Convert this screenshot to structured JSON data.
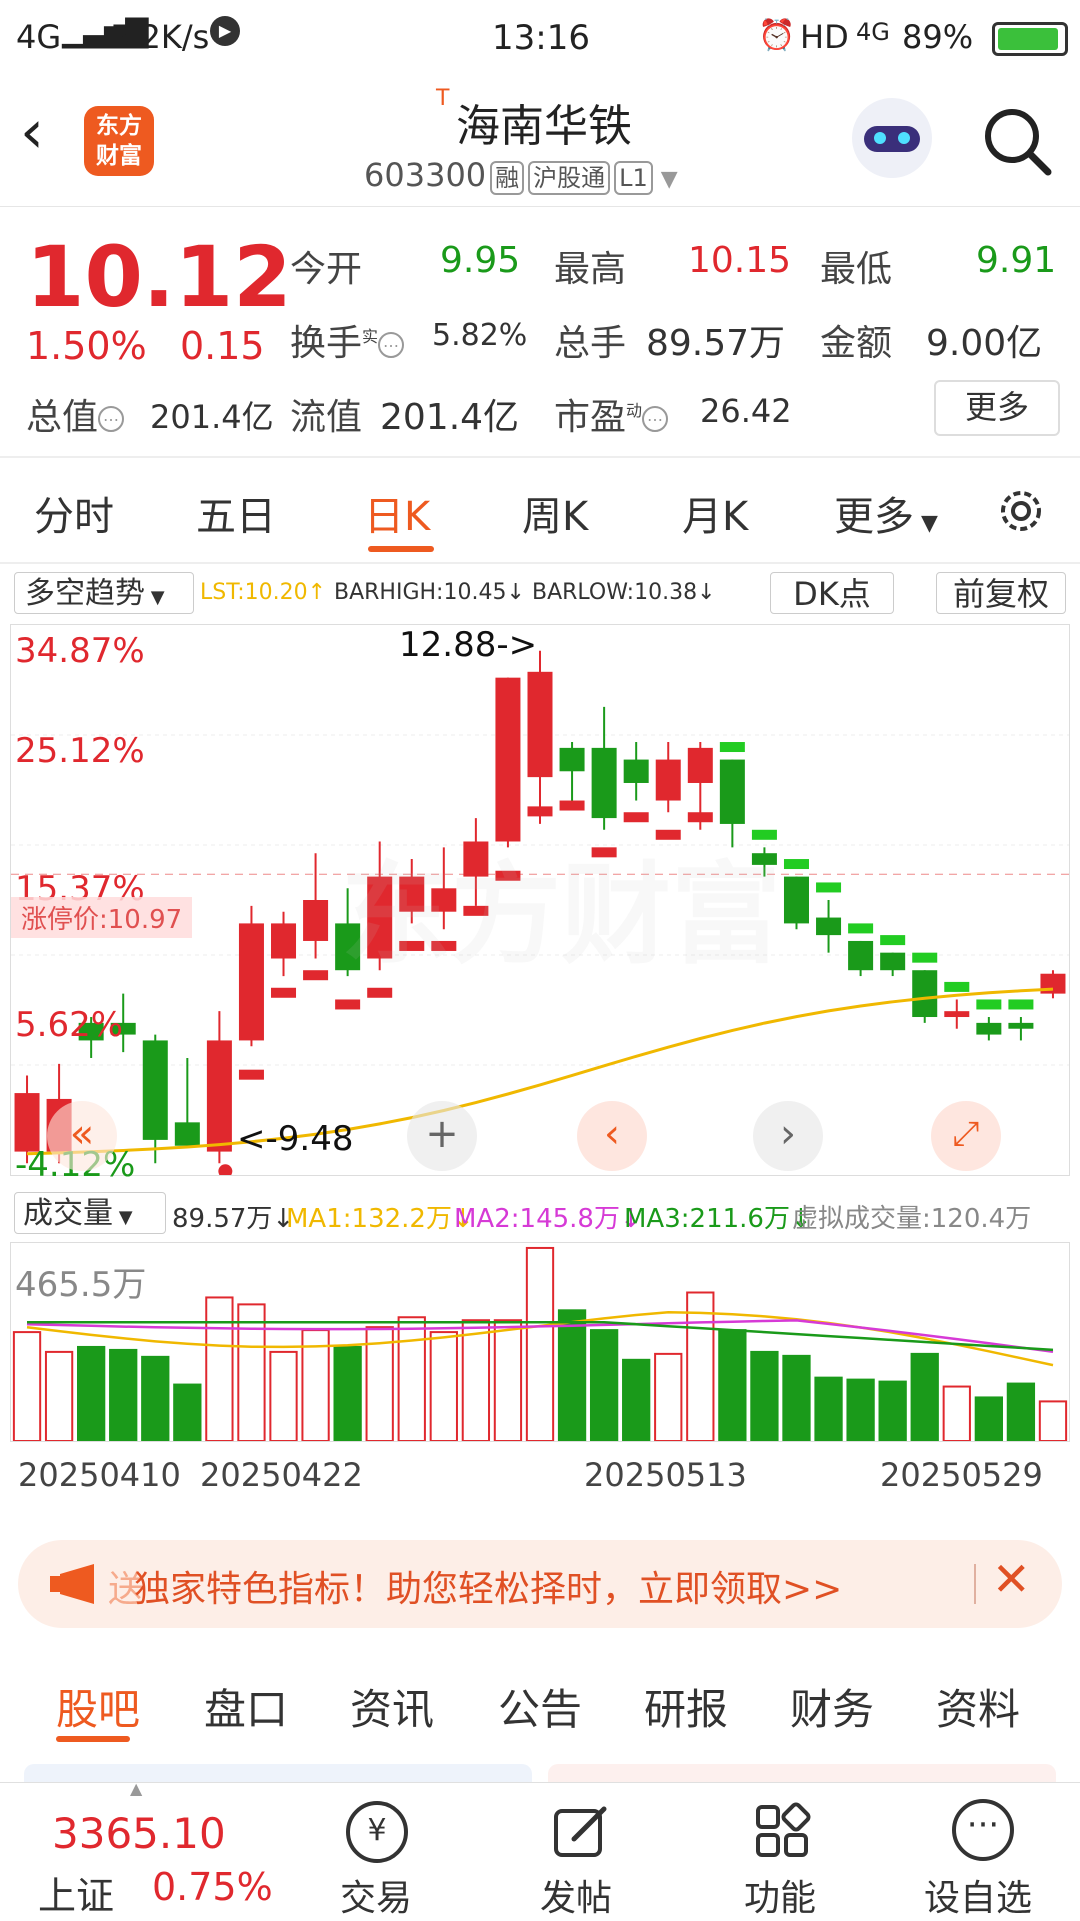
{
  "status_bar": {
    "network": "4G",
    "speed": "5.2K/s",
    "time": "13:16",
    "hd": "HD",
    "net2": "4G",
    "battery": "89%"
  },
  "header": {
    "logo_text": "东方\n财富",
    "prefix": "T",
    "stock_name": "海南华铁",
    "stock_code": "603300",
    "tags": [
      "融",
      "沪股通",
      "L1"
    ]
  },
  "quote": {
    "price": "10.12",
    "change_pct": "1.50%",
    "change": "0.15",
    "open_label": "今开",
    "open": "9.95",
    "high_label": "最高",
    "high": "10.15",
    "low_label": "最低",
    "low": "9.91",
    "turnover_label": "换手",
    "turnover_sup": "实",
    "turnover": "5.82%",
    "volume_label": "总手",
    "volume": "89.57万",
    "amount_label": "金额",
    "amount": "9.00亿",
    "mktcap_label": "总值",
    "mktcap": "201.4亿",
    "float_label": "流值",
    "float": "201.4亿",
    "pe_label": "市盈",
    "pe_sup": "动",
    "pe": "26.42",
    "more": "更多"
  },
  "period_tabs": [
    "分时",
    "五日",
    "日K",
    "周K",
    "月K",
    "更多"
  ],
  "active_tab": "日K",
  "indicator_bar": {
    "selector": "多空趋势",
    "lst": "LST:10.20↑",
    "barhigh": "BARHIGH:10.45↓",
    "barlow": "BARLOW:10.38↓",
    "dk_button": "DK点",
    "adjust_button": "前复权"
  },
  "kchart_labels": {
    "y_top": "34.87%",
    "y2": "25.12%",
    "y3": "15.37%",
    "y4": "5.62%",
    "y_bottom": "-4.12%",
    "limit_up": "涨停价:10.97",
    "high_marker": "12.88->",
    "low_marker": "<-9.48",
    "watermark": "东方财富"
  },
  "volume_bar": {
    "selector": "成交量",
    "vol": "89.57万↓",
    "ma1": "MA1:132.2万↓",
    "ma2": "MA2:145.8万↓",
    "ma3": "MA3:211.6万↓",
    "virtual": "虚拟成交量:120.4万",
    "max_label": "465.5万"
  },
  "dates": [
    "20250410",
    "20250422",
    "20250513",
    "20250529"
  ],
  "banner": {
    "text": "独家特色指标！助您轻松择时，立即领取>>",
    "prefix": "送"
  },
  "bottom_tabs": [
    "股吧",
    "盘口",
    "资讯",
    "公告",
    "研报",
    "财务",
    "资料"
  ],
  "footer": {
    "index_value": "3365.10",
    "index_name": "上证",
    "index_change": "0.75%",
    "items": [
      "交易",
      "发帖",
      "功能",
      "设自选"
    ]
  },
  "colors": {
    "up": "#e0282e",
    "down": "#1a9a1a",
    "accent": "#ee5a20",
    "ma": "#f0b800"
  },
  "chart_data": {
    "type": "candlestick",
    "y_range_pct": [
      -4.12,
      34.87
    ],
    "candles": [
      {
        "o": 8.6,
        "h": 9.25,
        "l": 8.5,
        "c": 9.1
      },
      {
        "o": 8.6,
        "h": 9.35,
        "l": 8.5,
        "c": 9.05
      },
      {
        "o": 9.7,
        "h": 9.75,
        "l": 9.4,
        "c": 9.55
      },
      {
        "o": 9.7,
        "h": 9.95,
        "l": 9.45,
        "c": 9.6
      },
      {
        "o": 9.55,
        "h": 9.6,
        "l": 8.5,
        "c": 8.7
      },
      {
        "o": 8.85,
        "h": 9.4,
        "l": 8.75,
        "c": 8.65
      },
      {
        "o": 8.6,
        "h": 9.8,
        "l": 8.5,
        "c": 9.55
      },
      {
        "o": 9.55,
        "h": 10.7,
        "l": 9.5,
        "c": 10.55
      },
      {
        "o": 10.25,
        "h": 10.65,
        "l": 10.1,
        "c": 10.55
      },
      {
        "o": 10.4,
        "h": 11.15,
        "l": 10.25,
        "c": 10.75
      },
      {
        "o": 10.55,
        "h": 10.85,
        "l": 10.1,
        "c": 10.15
      },
      {
        "o": 10.25,
        "h": 11.25,
        "l": 10.15,
        "c": 10.95
      },
      {
        "o": 10.65,
        "h": 11.1,
        "l": 10.55,
        "c": 10.95
      },
      {
        "o": 10.65,
        "h": 11.2,
        "l": 10.5,
        "c": 10.85
      },
      {
        "o": 10.95,
        "h": 11.45,
        "l": 10.7,
        "c": 11.25
      },
      {
        "o": 11.25,
        "h": 12.1,
        "l": 11.2,
        "c": 12.65
      },
      {
        "o": 11.8,
        "h": 12.88,
        "l": 11.4,
        "c": 12.7
      },
      {
        "o": 12.05,
        "h": 12.1,
        "l": 11.55,
        "c": 11.85
      },
      {
        "o": 12.05,
        "h": 12.4,
        "l": 11.35,
        "c": 11.45
      },
      {
        "o": 11.95,
        "h": 12.1,
        "l": 11.6,
        "c": 11.75
      },
      {
        "o": 11.6,
        "h": 12.1,
        "l": 11.5,
        "c": 11.95
      },
      {
        "o": 11.75,
        "h": 12.1,
        "l": 11.35,
        "c": 12.05
      },
      {
        "o": 11.95,
        "h": 11.95,
        "l": 11.2,
        "c": 11.4
      },
      {
        "o": 11.15,
        "h": 11.2,
        "l": 10.95,
        "c": 11.05
      },
      {
        "o": 10.95,
        "h": 10.95,
        "l": 10.5,
        "c": 10.55
      },
      {
        "o": 10.6,
        "h": 10.75,
        "l": 10.3,
        "c": 10.45
      },
      {
        "o": 10.4,
        "h": 10.4,
        "l": 10.1,
        "c": 10.15
      },
      {
        "o": 10.3,
        "h": 10.3,
        "l": 10.1,
        "c": 10.15
      },
      {
        "o": 10.15,
        "h": 10.15,
        "l": 9.7,
        "c": 9.75
      },
      {
        "o": 9.75,
        "h": 9.9,
        "l": 9.65,
        "c": 9.8
      },
      {
        "o": 9.7,
        "h": 9.75,
        "l": 9.55,
        "c": 9.6
      },
      {
        "o": 9.7,
        "h": 9.75,
        "l": 9.55,
        "c": 9.65
      },
      {
        "o": 9.95,
        "h": 10.15,
        "l": 9.91,
        "c": 10.12
      }
    ],
    "volume_max_wan": 465.5
  }
}
